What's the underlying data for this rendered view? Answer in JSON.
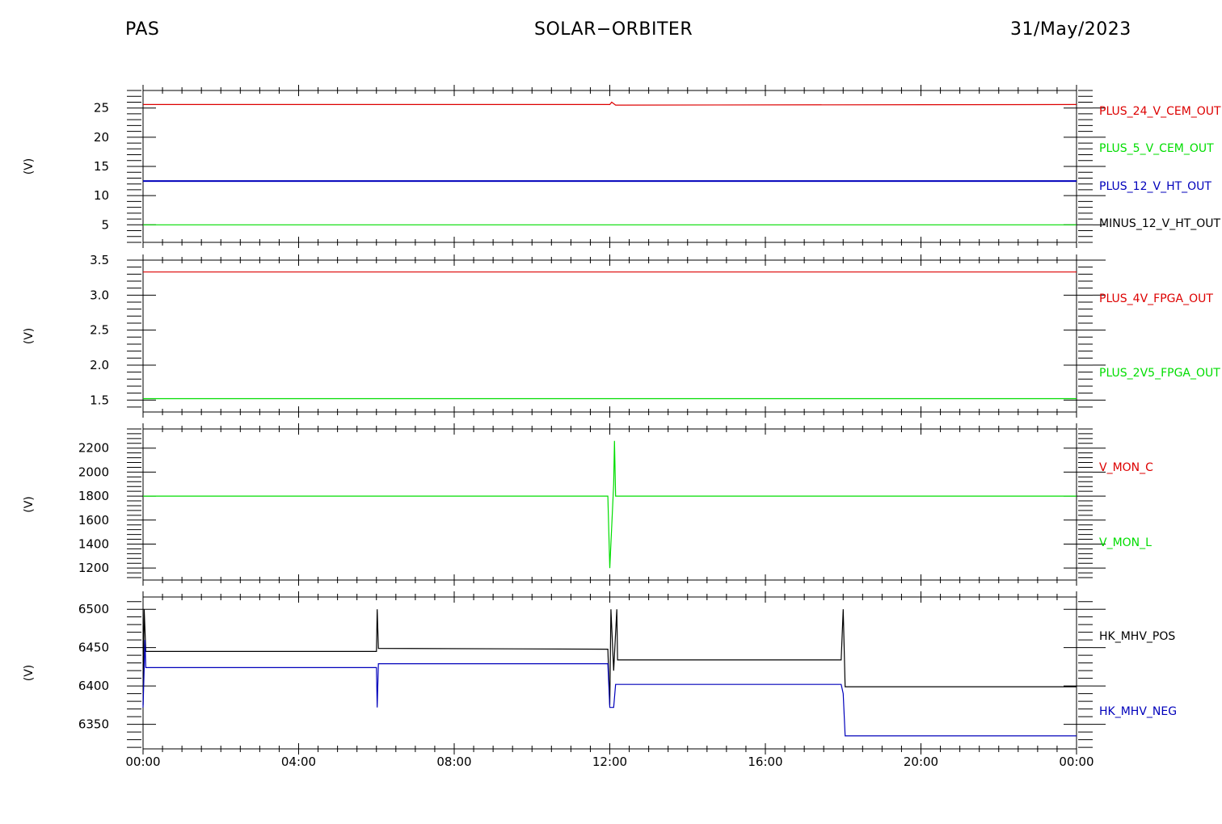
{
  "header": {
    "instrument": "PAS",
    "mission": "SOLAR−ORBITER",
    "date": "31/May/2023"
  },
  "colors": {
    "red": "#dd0000",
    "green": "#00dd00",
    "blue": "#0000bb",
    "black": "#000000"
  },
  "chart_data": [
    {
      "type": "line",
      "ylabel": "(V)",
      "ylim": [
        2.0,
        28.0
      ],
      "yticks": [
        5,
        10,
        15,
        20,
        25
      ],
      "ytick_labels": [
        "5",
        "10",
        "15",
        "20",
        "25"
      ],
      "x_unit": "hours",
      "series": [
        {
          "name": "PLUS_24_V_CEM_OUT",
          "color": "#dd0000",
          "points": [
            [
              0,
              25.6
            ],
            [
              12.0,
              25.6
            ],
            [
              12.05,
              26.0
            ],
            [
              12.15,
              25.5
            ],
            [
              24,
              25.6
            ]
          ]
        },
        {
          "name": "PLUS_5_V_CEM_OUT",
          "color": "#00dd00",
          "points": []
        },
        {
          "name": "PLUS_12_V_HT_OUT",
          "color": "#0000bb",
          "points": [
            [
              0,
              12.5
            ],
            [
              24,
              12.5
            ]
          ]
        },
        {
          "name": "MINUS_12_V_HT_OUT",
          "color": "#000000",
          "points": []
        },
        {
          "name": "",
          "color": "#00dd00",
          "points": [
            [
              0,
              5.0
            ],
            [
              24,
              5.0
            ]
          ]
        }
      ]
    },
    {
      "type": "line",
      "ylabel": "(V)",
      "ylim": [
        1.33,
        3.5
      ],
      "yticks": [
        1.5,
        2.0,
        2.5,
        3.0,
        3.5
      ],
      "ytick_labels": [
        "1.5",
        "2.0",
        "2.5",
        "3.0",
        "3.5"
      ],
      "x_unit": "hours",
      "series": [
        {
          "name": "PLUS_4V_FPGA_OUT",
          "color": "#dd0000",
          "points": [
            [
              0,
              3.33
            ],
            [
              24,
              3.33
            ]
          ]
        },
        {
          "name": "PLUS_2V5_FPGA_OUT",
          "color": "#00dd00",
          "points": [
            [
              0,
              1.52
            ],
            [
              24,
              1.52
            ]
          ]
        }
      ]
    },
    {
      "type": "line",
      "ylabel": "(V)",
      "ylim": [
        1100,
        2360
      ],
      "yticks": [
        1200,
        1400,
        1600,
        1800,
        2000,
        2200
      ],
      "ytick_labels": [
        "1200",
        "1400",
        "1600",
        "1800",
        "2000",
        "2200"
      ],
      "x_unit": "hours",
      "series": [
        {
          "name": "V_MON_C",
          "color": "#dd0000",
          "points": []
        },
        {
          "name": "V_MON_L",
          "color": "#00dd00",
          "points": [
            [
              0,
              1800
            ],
            [
              11.95,
              1800
            ],
            [
              12.0,
              1200
            ],
            [
              12.1,
              1900
            ],
            [
              12.12,
              2260
            ],
            [
              12.15,
              1800
            ],
            [
              24,
              1800
            ]
          ]
        }
      ]
    },
    {
      "type": "line",
      "ylabel": "(V)",
      "ylim": [
        6318,
        6516
      ],
      "yticks": [
        6350,
        6400,
        6450,
        6500
      ],
      "ytick_labels": [
        "6350",
        "6400",
        "6450",
        "6500"
      ],
      "x_unit": "hours",
      "series": [
        {
          "name": "HK_MHV_POS",
          "color": "#000000",
          "points": [
            [
              0,
              6375
            ],
            [
              0.03,
              6500
            ],
            [
              0.07,
              6445
            ],
            [
              6.0,
              6445
            ],
            [
              6.02,
              6500
            ],
            [
              6.05,
              6449
            ],
            [
              11.95,
              6448
            ],
            [
              12.0,
              6375
            ],
            [
              12.03,
              6500
            ],
            [
              12.1,
              6420
            ],
            [
              12.18,
              6500
            ],
            [
              12.2,
              6434
            ],
            [
              17.95,
              6434
            ],
            [
              18.0,
              6500
            ],
            [
              18.05,
              6399
            ],
            [
              24,
              6399
            ]
          ]
        },
        {
          "name": "HK_MHV_NEG",
          "color": "#0000bb",
          "points": [
            [
              0,
              6372
            ],
            [
              0.05,
              6460
            ],
            [
              0.07,
              6424
            ],
            [
              6.0,
              6424
            ],
            [
              6.02,
              6372
            ],
            [
              6.05,
              6429
            ],
            [
              11.95,
              6429
            ],
            [
              12.0,
              6372
            ],
            [
              12.1,
              6372
            ],
            [
              12.15,
              6402
            ],
            [
              17.95,
              6402
            ],
            [
              18.0,
              6390
            ],
            [
              18.05,
              6335
            ],
            [
              24,
              6335
            ]
          ]
        }
      ]
    }
  ],
  "x_axis": {
    "xlim": [
      0,
      24
    ],
    "major_ticks": [
      0,
      4,
      8,
      12,
      16,
      20,
      24
    ],
    "tick_labels": [
      "00:00",
      "04:00",
      "08:00",
      "12:00",
      "16:00",
      "20:00",
      "00:00"
    ]
  }
}
